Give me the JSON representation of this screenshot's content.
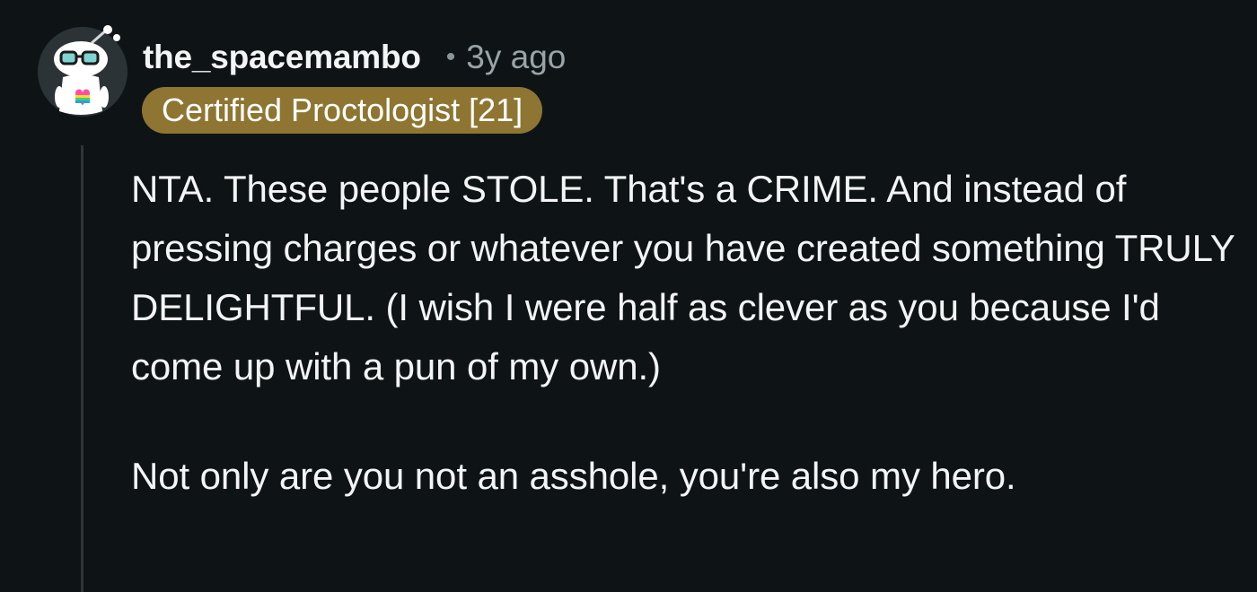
{
  "comment": {
    "author": "the_spacemambo",
    "separator": "•",
    "age": "3y ago",
    "flair": "Certified Proctologist [21]",
    "paragraphs": [
      "NTA. These people STOLE. That's a CRIME. And instead of pressing charges or whatever you have created something TRULY DELIGHTFUL. (I wish I were half as clever as you because I'd come up with a pun of my own.)",
      "Not only are you not an asshole, you're also my hero."
    ]
  },
  "colors": {
    "background": "#0e1416",
    "flair_background": "#8e7532",
    "text": "#f2f4f5",
    "meta_text": "#9aa3a8",
    "thread_line": "#2f3538"
  },
  "icons": {
    "avatar": "snoo-avatar-with-glasses-and-rainbow-heart-icon"
  }
}
